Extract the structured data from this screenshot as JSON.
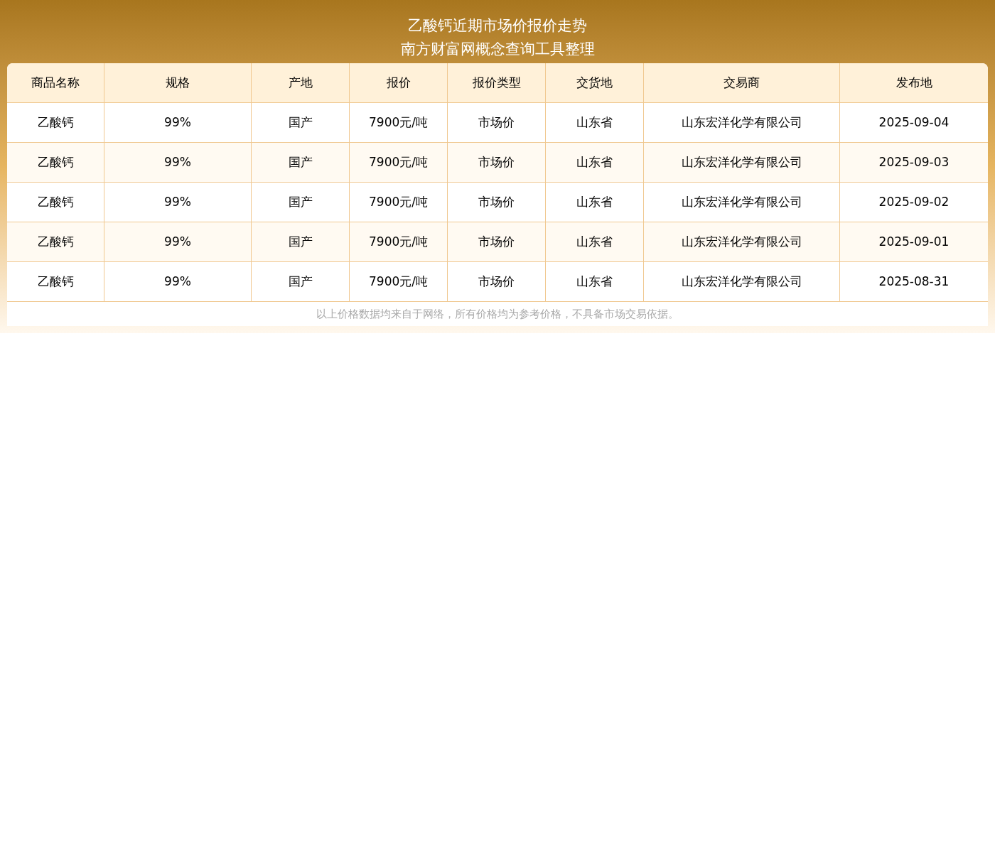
{
  "title": {
    "line1": "乙酸钙近期市场价报价走势",
    "line2": "南方财富网概念查询工具整理"
  },
  "table": {
    "columns": [
      "商品名称",
      "规格",
      "产地",
      "报价",
      "报价类型",
      "交货地",
      "交易商",
      "发布地"
    ],
    "rows": [
      [
        "乙酸钙",
        "99%",
        "国产",
        "7900元/吨",
        "市场价",
        "山东省",
        "山东宏洋化学有限公司",
        "2025-09-04"
      ],
      [
        "乙酸钙",
        "99%",
        "国产",
        "7900元/吨",
        "市场价",
        "山东省",
        "山东宏洋化学有限公司",
        "2025-09-03"
      ],
      [
        "乙酸钙",
        "99%",
        "国产",
        "7900元/吨",
        "市场价",
        "山东省",
        "山东宏洋化学有限公司",
        "2025-09-02"
      ],
      [
        "乙酸钙",
        "99%",
        "国产",
        "7900元/吨",
        "市场价",
        "山东省",
        "山东宏洋化学有限公司",
        "2025-09-01"
      ],
      [
        "乙酸钙",
        "99%",
        "国产",
        "7900元/吨",
        "市场价",
        "山东省",
        "山东宏洋化学有限公司",
        "2025-08-31"
      ]
    ]
  },
  "note": "以上价格数据均来自于网络，所有价格均为参考价格，不具备市场交易依据。"
}
